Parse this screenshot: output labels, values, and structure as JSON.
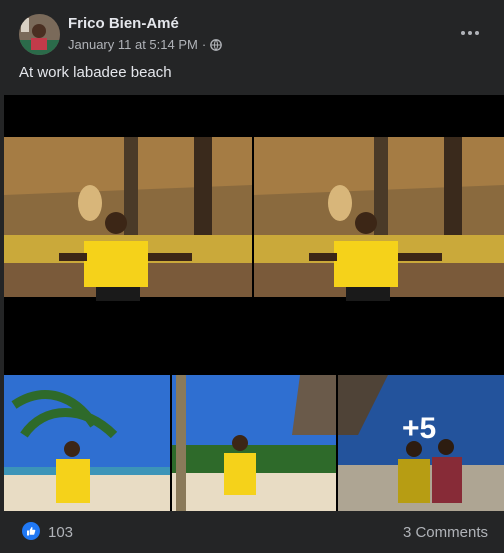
{
  "post": {
    "author": "Frico Bien-Amé",
    "timestamp": "January 11 at 5:14 PM",
    "separator": "·",
    "privacy_icon": "globe-icon",
    "caption": "At work labadee beach",
    "more_icon": "more-horizontal-icon"
  },
  "photos": {
    "overflow_label": "+5"
  },
  "reactions": {
    "icon": "like-thumb-icon",
    "count": "103",
    "comments": "3 Comments"
  },
  "colors": {
    "background": "#242526",
    "text_primary": "#e4e6eb",
    "text_secondary": "#b0b3b8",
    "like_blue": "#2078f4",
    "shirt_yellow": "#f5d21a"
  }
}
